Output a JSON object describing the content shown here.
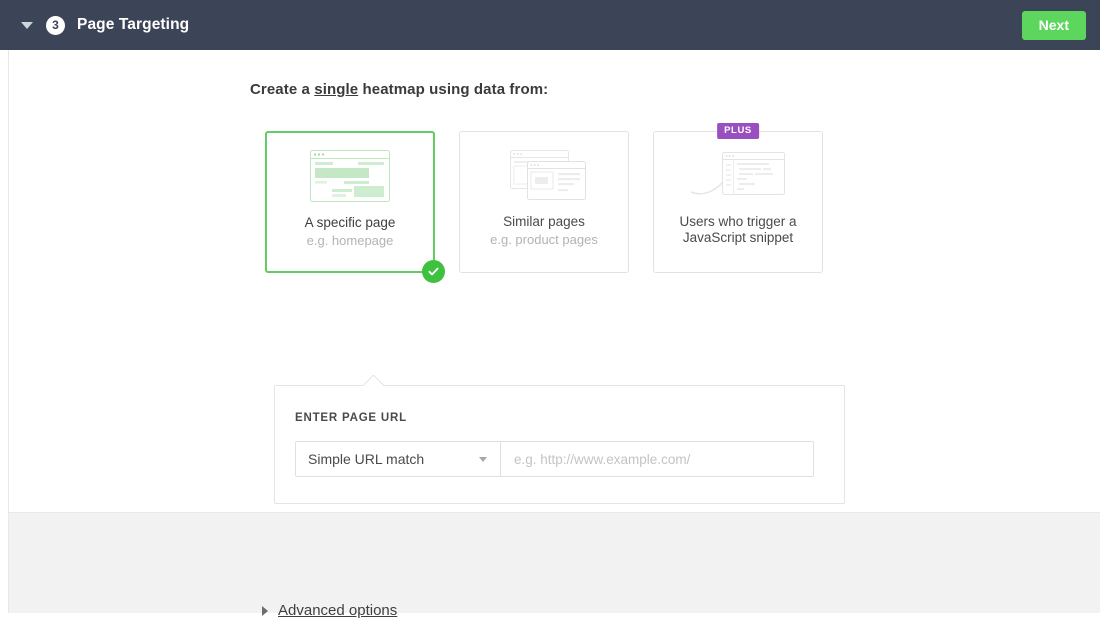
{
  "header": {
    "collapse_icon": "chevron-down-icon",
    "step_number": "3",
    "title": "Page Targeting",
    "next_label": "Next",
    "accent_green": "#5cd65c",
    "bar_color": "#3c4458"
  },
  "main": {
    "prompt_prefix": "Create a ",
    "prompt_emphasis": "single",
    "prompt_suffix": " heatmap using data from:",
    "cards": [
      {
        "title": "A specific page",
        "subtitle": "e.g. homepage",
        "selected": true,
        "badge": null,
        "art": "browser-window-illustration"
      },
      {
        "title": "Similar pages",
        "subtitle": "e.g. product pages",
        "selected": false,
        "badge": null,
        "art": "stacked-windows-illustration"
      },
      {
        "title": "Users who trigger a JavaScript snippet",
        "title_line1": "Users who trigger a",
        "title_line2": "JavaScript snippet",
        "subtitle": "",
        "selected": false,
        "badge": "PLUS",
        "art": "code-editor-illustration"
      }
    ],
    "url_panel": {
      "label": "ENTER PAGE URL",
      "match_type": "Simple URL match",
      "match_options": [
        "Simple URL match"
      ],
      "url_value": "",
      "url_placeholder": "e.g. http://www.example.com/"
    }
  },
  "footer": {
    "advanced_label": "Advanced options",
    "advanced_icon": "triangle-right-icon"
  },
  "colors": {
    "selected_border": "#63cc63",
    "check_badge": "#3ec13e",
    "plus_badge": "#9a4fc0",
    "footer_bg": "#f2f2f2"
  }
}
